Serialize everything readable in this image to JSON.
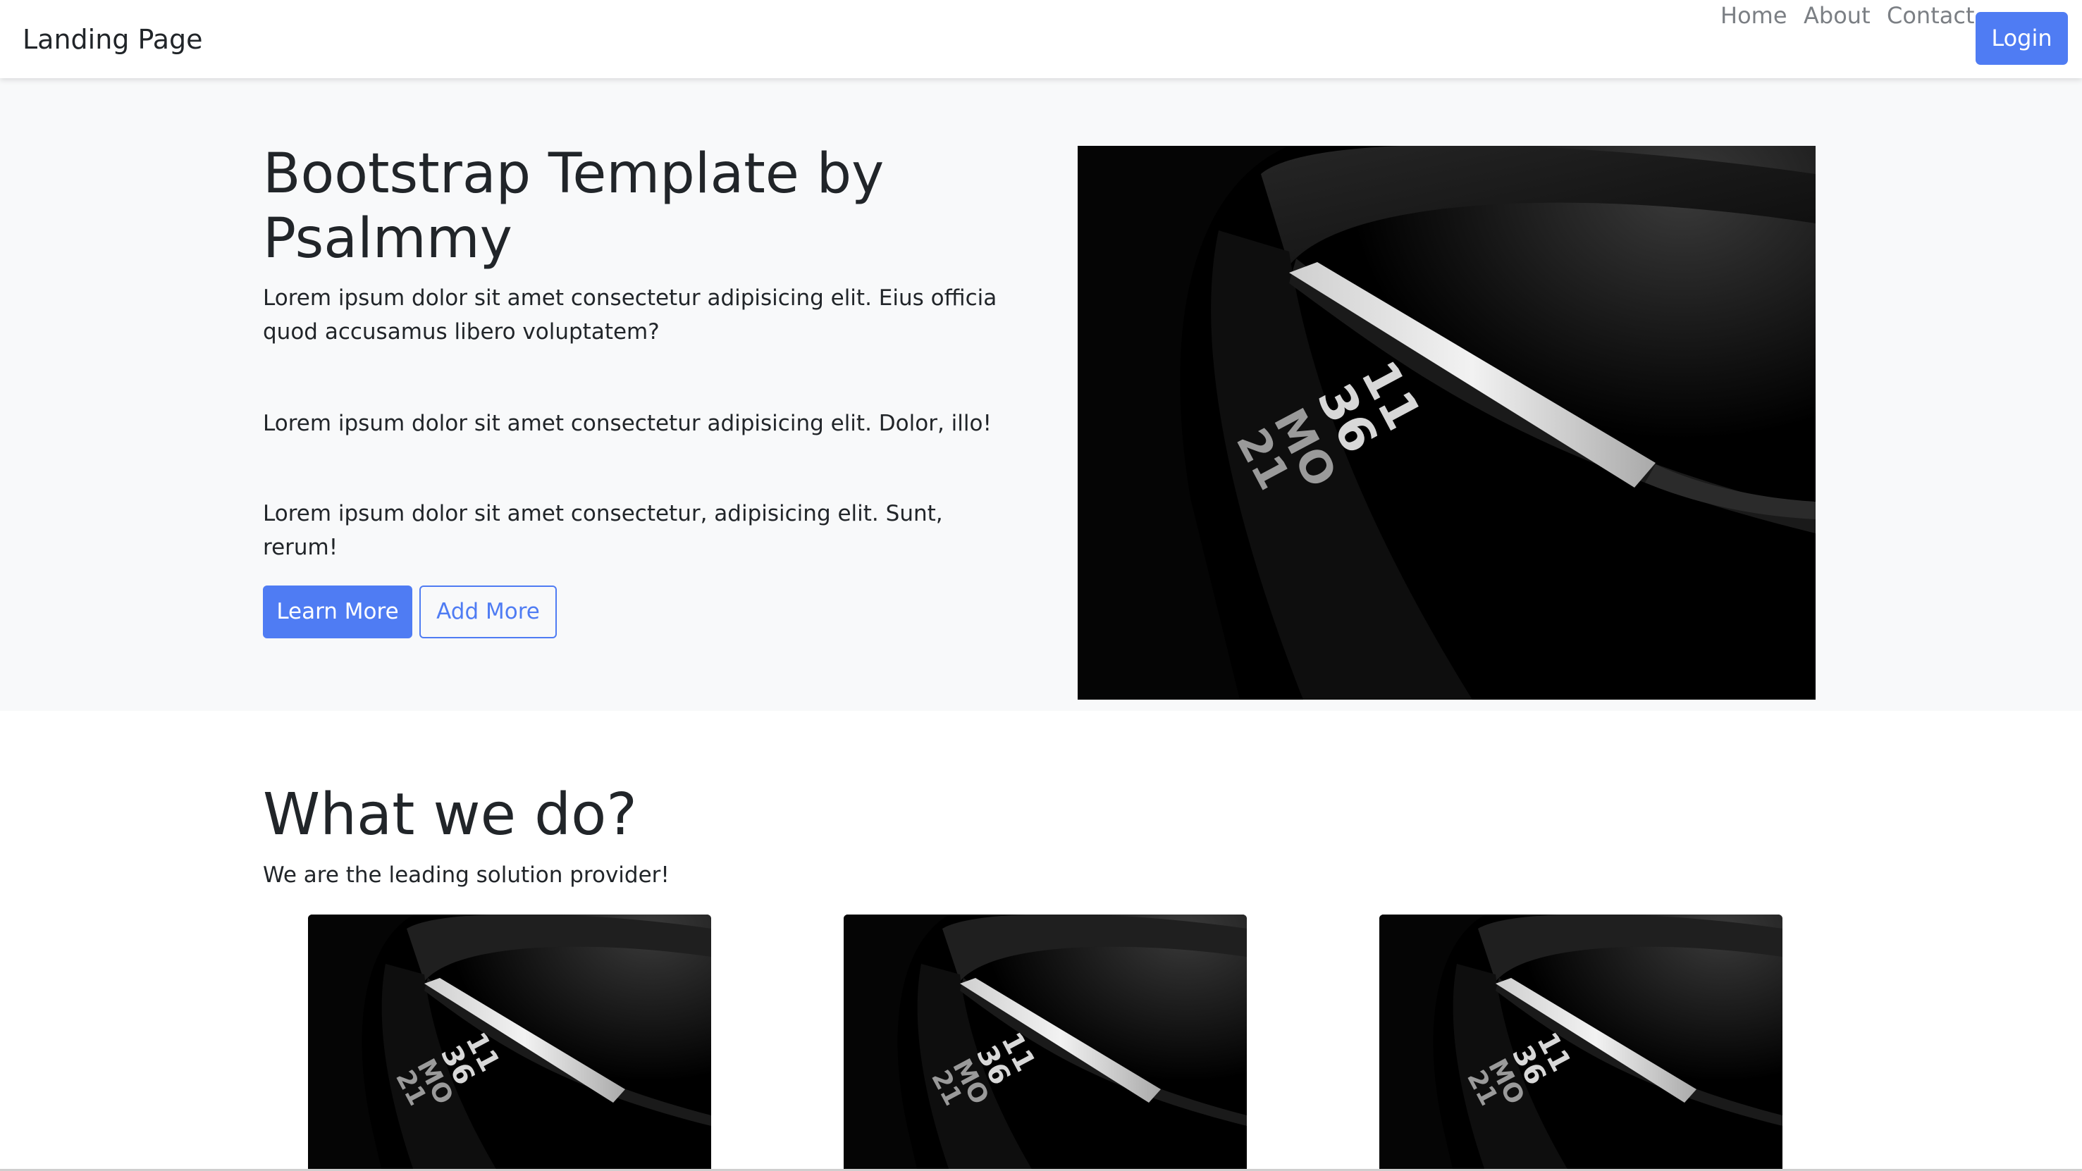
{
  "navbar": {
    "brand": "Landing Page",
    "links": [
      "Home",
      "About",
      "Contact"
    ],
    "login_label": "Login"
  },
  "hero": {
    "title": "Bootstrap Template by Psalmmy",
    "paragraphs": [
      "Lorem ipsum dolor sit amet consectetur adipisicing elit. Eius officia quod accusamus libero voluptatem?",
      "Lorem ipsum dolor sit amet consectetur adipisicing elit. Dolor, illo!",
      "Lorem ipsum dolor sit amet consectetur, adipisicing elit. Sunt, rerum!"
    ],
    "primary_button": "Learn More",
    "secondary_button": "Add More",
    "image_icon": "fitness-band-photo"
  },
  "what_we_do": {
    "title": "What we do?",
    "subtitle": "We are the leading solution provider!",
    "card_image_icon": "fitness-band-photo"
  },
  "colors": {
    "accent": "#4f7cf3",
    "hero_bg": "#f8f9fa",
    "text": "#212529",
    "nav_link": "#7b7f84"
  }
}
